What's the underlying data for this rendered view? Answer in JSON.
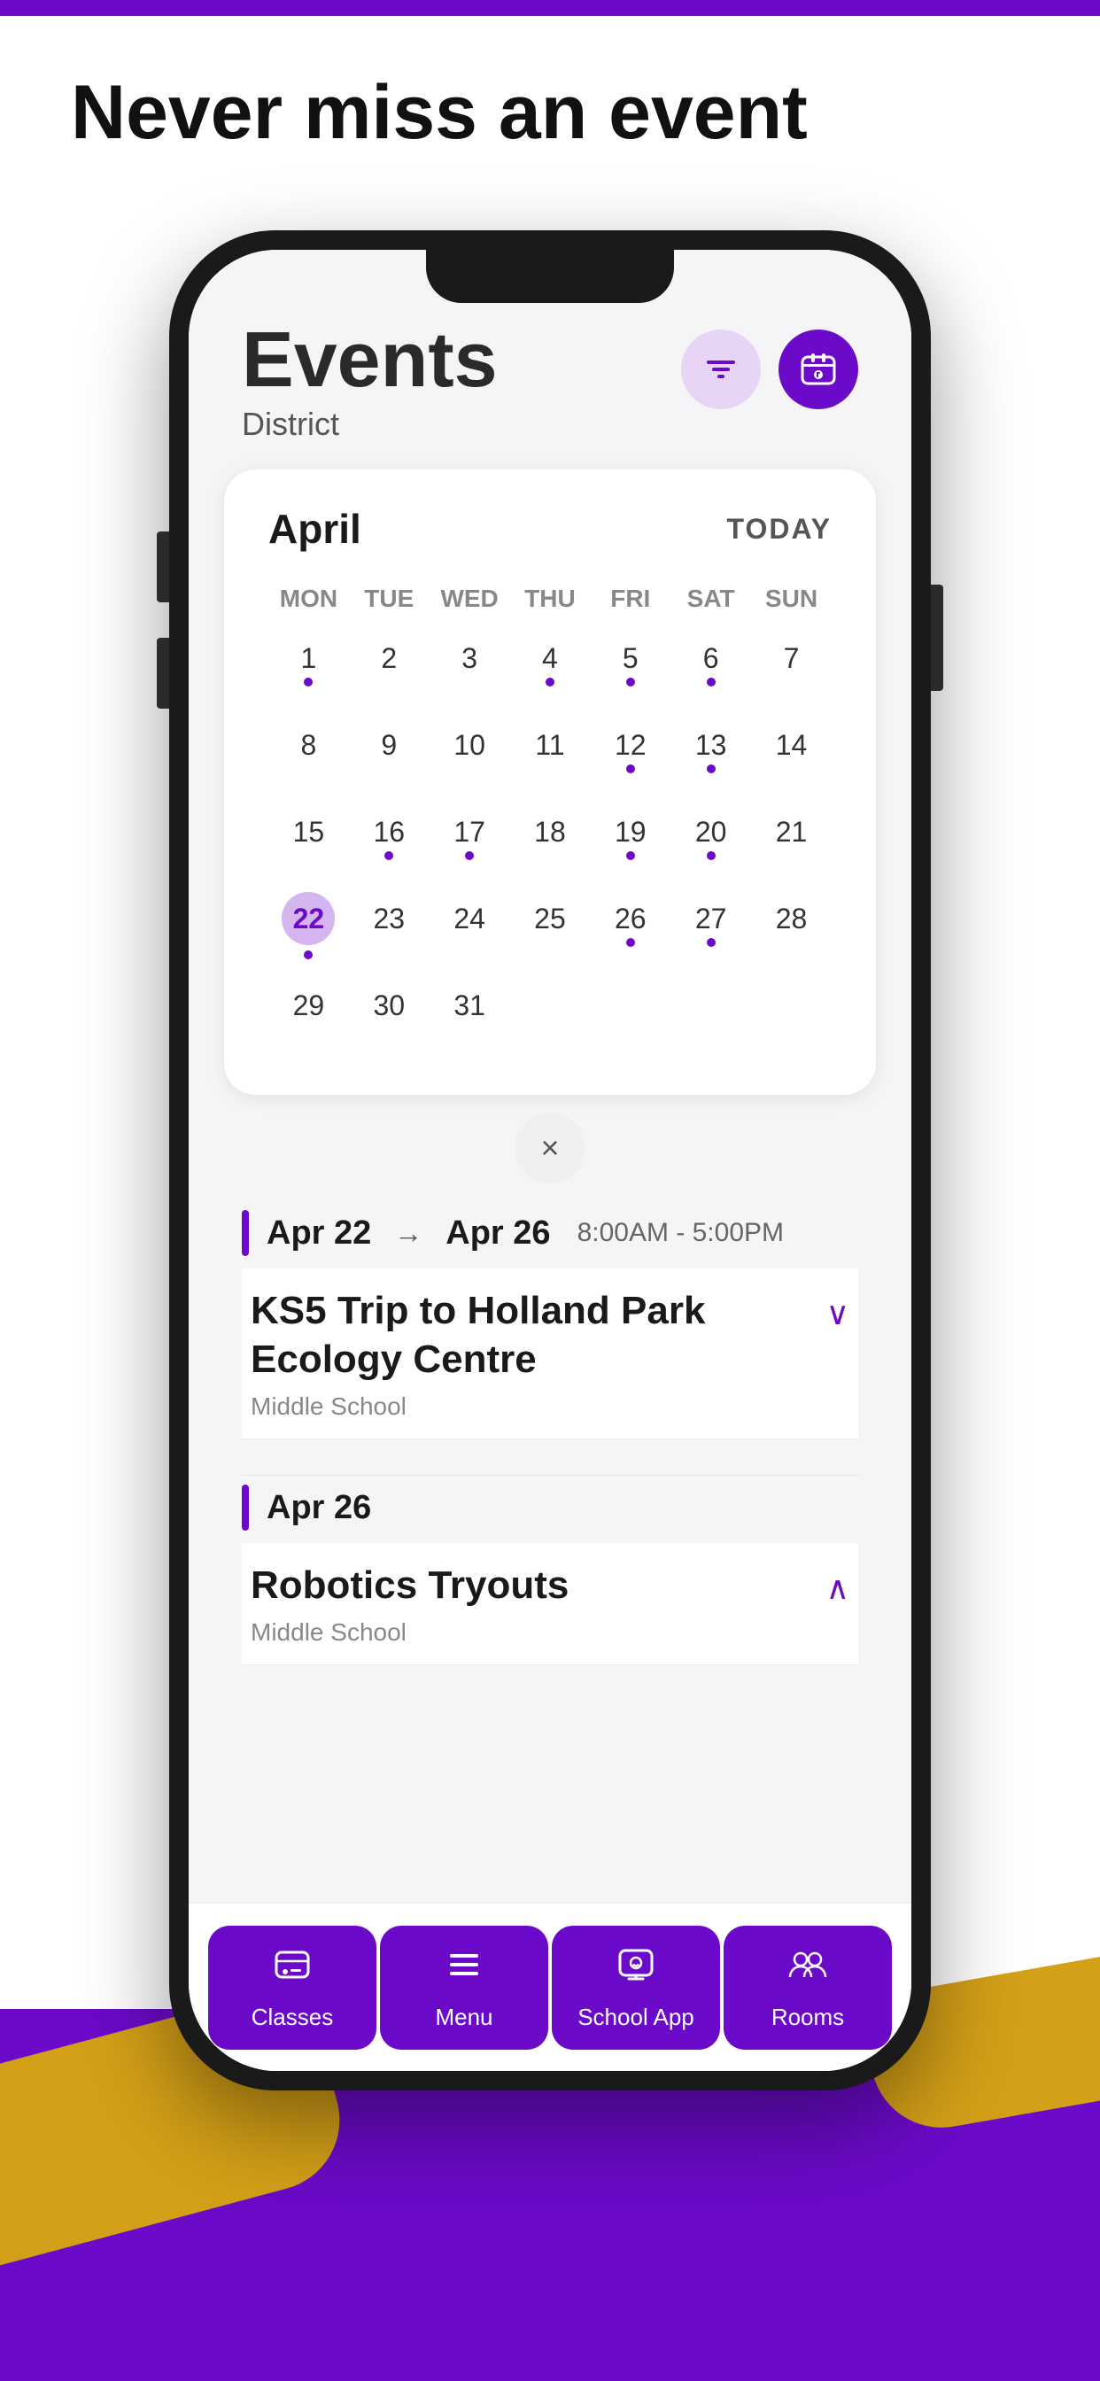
{
  "page": {
    "headline": "Never miss an event",
    "top_bar_color": "#6B0AC9",
    "background": "#ffffff"
  },
  "phone": {
    "screen": {
      "header": {
        "title": "Events",
        "subtitle": "District",
        "filter_btn_aria": "Filter",
        "calendar_btn_aria": "Calendar view"
      },
      "calendar": {
        "month": "April",
        "today_label": "TODAY",
        "day_headers": [
          "MON",
          "TUE",
          "WED",
          "THU",
          "FRI",
          "SAT",
          "SUN"
        ],
        "weeks": [
          [
            {
              "num": "1",
              "dot": true,
              "selected": false
            },
            {
              "num": "2",
              "dot": false,
              "selected": false
            },
            {
              "num": "3",
              "dot": false,
              "selected": false
            },
            {
              "num": "4",
              "dot": true,
              "selected": false
            },
            {
              "num": "5",
              "dot": true,
              "selected": false
            },
            {
              "num": "6",
              "dot": true,
              "selected": false
            },
            {
              "num": "7",
              "dot": false,
              "selected": false
            }
          ],
          [
            {
              "num": "8",
              "dot": false,
              "selected": false
            },
            {
              "num": "9",
              "dot": false,
              "selected": false
            },
            {
              "num": "10",
              "dot": false,
              "selected": false
            },
            {
              "num": "11",
              "dot": false,
              "selected": false
            },
            {
              "num": "12",
              "dot": true,
              "selected": false
            },
            {
              "num": "13",
              "dot": true,
              "selected": false
            },
            {
              "num": "14",
              "dot": false,
              "selected": false
            }
          ],
          [
            {
              "num": "15",
              "dot": false,
              "selected": false
            },
            {
              "num": "16",
              "dot": true,
              "selected": false
            },
            {
              "num": "17",
              "dot": true,
              "selected": false
            },
            {
              "num": "18",
              "dot": false,
              "selected": false
            },
            {
              "num": "19",
              "dot": true,
              "selected": false
            },
            {
              "num": "20",
              "dot": true,
              "selected": false
            },
            {
              "num": "21",
              "dot": false,
              "selected": false
            }
          ],
          [
            {
              "num": "22",
              "dot": true,
              "selected": true
            },
            {
              "num": "23",
              "dot": false,
              "selected": false
            },
            {
              "num": "24",
              "dot": false,
              "selected": false
            },
            {
              "num": "25",
              "dot": false,
              "selected": false
            },
            {
              "num": "26",
              "dot": true,
              "selected": false
            },
            {
              "num": "27",
              "dot": true,
              "selected": false
            },
            {
              "num": "28",
              "dot": false,
              "selected": false
            }
          ],
          [
            {
              "num": "29",
              "dot": false,
              "selected": false
            },
            {
              "num": "30",
              "dot": false,
              "selected": false
            },
            {
              "num": "31",
              "dot": false,
              "selected": false
            },
            {
              "num": "",
              "dot": false,
              "selected": false
            },
            {
              "num": "",
              "dot": false,
              "selected": false
            },
            {
              "num": "",
              "dot": false,
              "selected": false
            },
            {
              "num": "",
              "dot": false,
              "selected": false
            }
          ]
        ]
      },
      "close_button": "×",
      "events": [
        {
          "date_start": "Apr 22",
          "date_end": "Apr 26",
          "time": "8:00AM  -  5:00PM",
          "title": "KS5 Trip to Holland Park Ecology Centre",
          "school": "Middle School",
          "expanded": false,
          "chevron": "∨"
        },
        {
          "date_start": "Apr 26",
          "date_end": null,
          "time": null,
          "title": "Robotics Tryouts",
          "school": "Middle School",
          "expanded": true,
          "chevron": "∧"
        }
      ],
      "nav": [
        {
          "label": "Classes",
          "icon": "🎓"
        },
        {
          "label": "Menu",
          "icon": "☰"
        },
        {
          "label": "School App",
          "icon": "💬"
        },
        {
          "label": "Rooms",
          "icon": "👥"
        }
      ]
    }
  }
}
